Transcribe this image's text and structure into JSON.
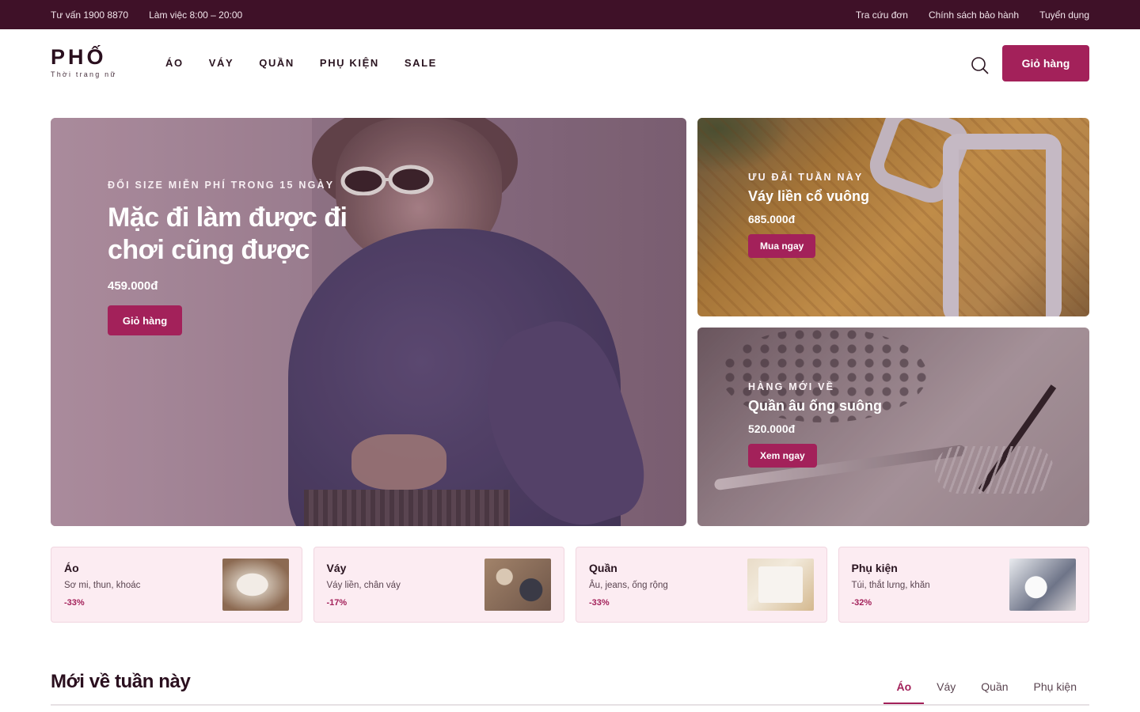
{
  "topbar": {
    "hotline": "Tư vấn 1900 8870",
    "hours": "Làm việc 8:00 – 20:00",
    "links": [
      "Tra cứu đơn",
      "Chính sách bảo hành",
      "Tuyển dụng"
    ]
  },
  "header": {
    "logo_name": "PHỐ",
    "logo_tagline": "Thời trang nữ",
    "nav": [
      "ÁO",
      "VÁY",
      "QUẦN",
      "PHỤ KIỆN",
      "SALE"
    ],
    "search_icon": "search-icon",
    "cart_label": "Giỏ hàng"
  },
  "hero": {
    "eyebrow": "ĐỔI SIZE MIỄN PHÍ TRONG 15 NGÀY",
    "title": "Mặc đi làm được đi chơi cũng được",
    "price": "459.000đ",
    "button": "Giỏ hàng"
  },
  "promos": [
    {
      "eyebrow": "ƯU ĐÃI TUẦN NÀY",
      "title": "Váy liền cổ vuông",
      "price": "685.000đ",
      "button": "Mua ngay"
    },
    {
      "eyebrow": "HÀNG MỚI VỀ",
      "title": "Quần âu ống suông",
      "price": "520.000đ",
      "button": "Xem ngay"
    }
  ],
  "categories": [
    {
      "name": "Áo",
      "desc": "Sơ mi, thun, khoác",
      "discount": "-33%"
    },
    {
      "name": "Váy",
      "desc": "Váy liền, chân váy",
      "discount": "-17%"
    },
    {
      "name": "Quần",
      "desc": "Âu, jeans, ống rộng",
      "discount": "-33%"
    },
    {
      "name": "Phụ kiện",
      "desc": "Túi, thắt lưng, khăn",
      "discount": "-32%"
    }
  ],
  "section": {
    "title": "Mới về tuần này",
    "tabs": [
      "Áo",
      "Váy",
      "Quần",
      "Phụ kiện"
    ],
    "active_tab": "Áo"
  },
  "colors": {
    "topbar_bg": "#3f1128",
    "accent": "#a3215a",
    "card_bg": "#fcecf2"
  }
}
